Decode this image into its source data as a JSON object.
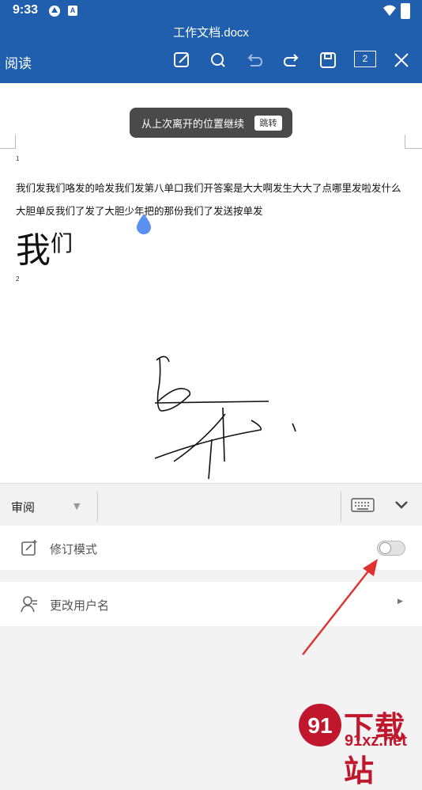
{
  "status_bar": {
    "time": "9:33",
    "icons": [
      "app-a-icon",
      "app-b-icon",
      "wifi-icon",
      "battery-icon"
    ],
    "app_b_letter": "A"
  },
  "app_bar": {
    "title": "工作文档.docx",
    "mode_label": "阅读",
    "page_count": "2",
    "buttons": [
      "edit-icon",
      "search-icon",
      "undo-icon",
      "redo-icon",
      "save-icon",
      "page-count",
      "close-icon"
    ]
  },
  "document": {
    "toast": {
      "text": "从上次离开的位置继续",
      "action": "跳转"
    },
    "page1_number": "1",
    "line1": "我们发我们咯发的哈发我们发第八单口我们开答案是大大啊发生大大了点哪里发啦发什么",
    "line2": "大胆单反我们了发了大胆少年把的那份我们了发送按单发",
    "big_text_a": "我",
    "big_text_b": "们",
    "page2_number": "2"
  },
  "bottom_toolbar": {
    "review_label": "审阅",
    "keyboard_icon": "keyboard-icon",
    "collapse_icon": "chevron-down-icon"
  },
  "settings": {
    "revision_mode": {
      "label": "修订模式",
      "enabled": false
    },
    "change_username": {
      "label": "更改用户名"
    }
  },
  "watermark": {
    "title": "下载站",
    "url": "91xz.net"
  },
  "colors": {
    "header": "#1f5fad",
    "annotation_arrow": "#e03030",
    "watermark_red": "#c0172c"
  }
}
